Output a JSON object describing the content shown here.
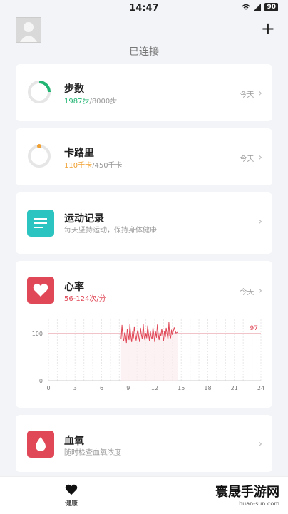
{
  "status_bar": {
    "time": "14:47",
    "battery": "90"
  },
  "header": {
    "connected_label": "已连接"
  },
  "steps": {
    "title": "步数",
    "value": "1987步",
    "goal": "/8000步",
    "date": "今天",
    "progress": 0.25
  },
  "calories": {
    "title": "卡路里",
    "value": "110千卡",
    "goal": "/450千卡",
    "date": "今天",
    "progress": 0.24
  },
  "exercise": {
    "title": "运动记录",
    "subtitle": "每天坚持运动，保持身体健康"
  },
  "heart_rate": {
    "title": "心率",
    "range": "56-124次/分",
    "date": "今天",
    "chart_data": {
      "type": "line",
      "x_ticks": [
        "0",
        "3",
        "6",
        "9",
        "12",
        "15",
        "18",
        "21",
        "24"
      ],
      "y_ticks": [
        "0",
        "100"
      ],
      "reference_value": 97,
      "reference_label": "97",
      "xlim": [
        0,
        24
      ],
      "ylim": [
        0,
        130
      ],
      "series": [
        {
          "x": [
            8.2,
            8.3,
            8.4,
            8.5,
            8.6,
            8.7,
            8.8,
            8.9,
            9.0,
            9.1,
            9.2,
            9.3,
            9.4,
            9.5,
            9.6,
            9.7,
            9.8,
            9.9,
            10.0,
            10.1,
            10.2,
            10.3,
            10.4,
            10.5,
            10.6,
            10.7,
            10.8,
            10.9,
            11.0,
            11.1,
            11.2,
            11.3,
            11.4,
            11.5,
            11.6,
            11.7,
            11.8,
            11.9,
            12.0,
            12.1,
            12.2,
            12.3,
            12.4,
            12.5,
            12.6,
            12.7,
            12.8,
            12.9,
            13.0,
            13.1,
            13.2,
            13.3,
            13.4,
            13.5,
            13.6,
            13.7,
            13.8,
            13.9,
            14.0,
            14.2,
            14.4,
            14.6
          ],
          "y": [
            88,
            118,
            92,
            84,
            102,
            96,
            80,
            110,
            98,
            86,
            120,
            94,
            82,
            104,
            90,
            115,
            97,
            85,
            100,
            108,
            93,
            82,
            112,
            96,
            88,
            121,
            95,
            86,
            101,
            90,
            117,
            99,
            84,
            106,
            93,
            88,
            113,
            97,
            82,
            104,
            91,
            119,
            98,
            86,
            103,
            94,
            110,
            96,
            84,
            105,
            92,
            112,
            99,
            87,
            124,
            95,
            90,
            108,
            97,
            112,
            101,
            103
          ]
        }
      ]
    }
  },
  "blood_oxygen": {
    "title": "血氧",
    "subtitle": "随时检查血氧浓度"
  },
  "nav": {
    "health_label": "健康"
  },
  "colors": {
    "steps": "#22b573",
    "calories": "#f0a030",
    "exercise": "#2cc4c0",
    "heart": "#e04858",
    "oxygen": "#e04858"
  },
  "watermark": {
    "name": "寰晟手游网",
    "url": "huan-sun.com"
  }
}
